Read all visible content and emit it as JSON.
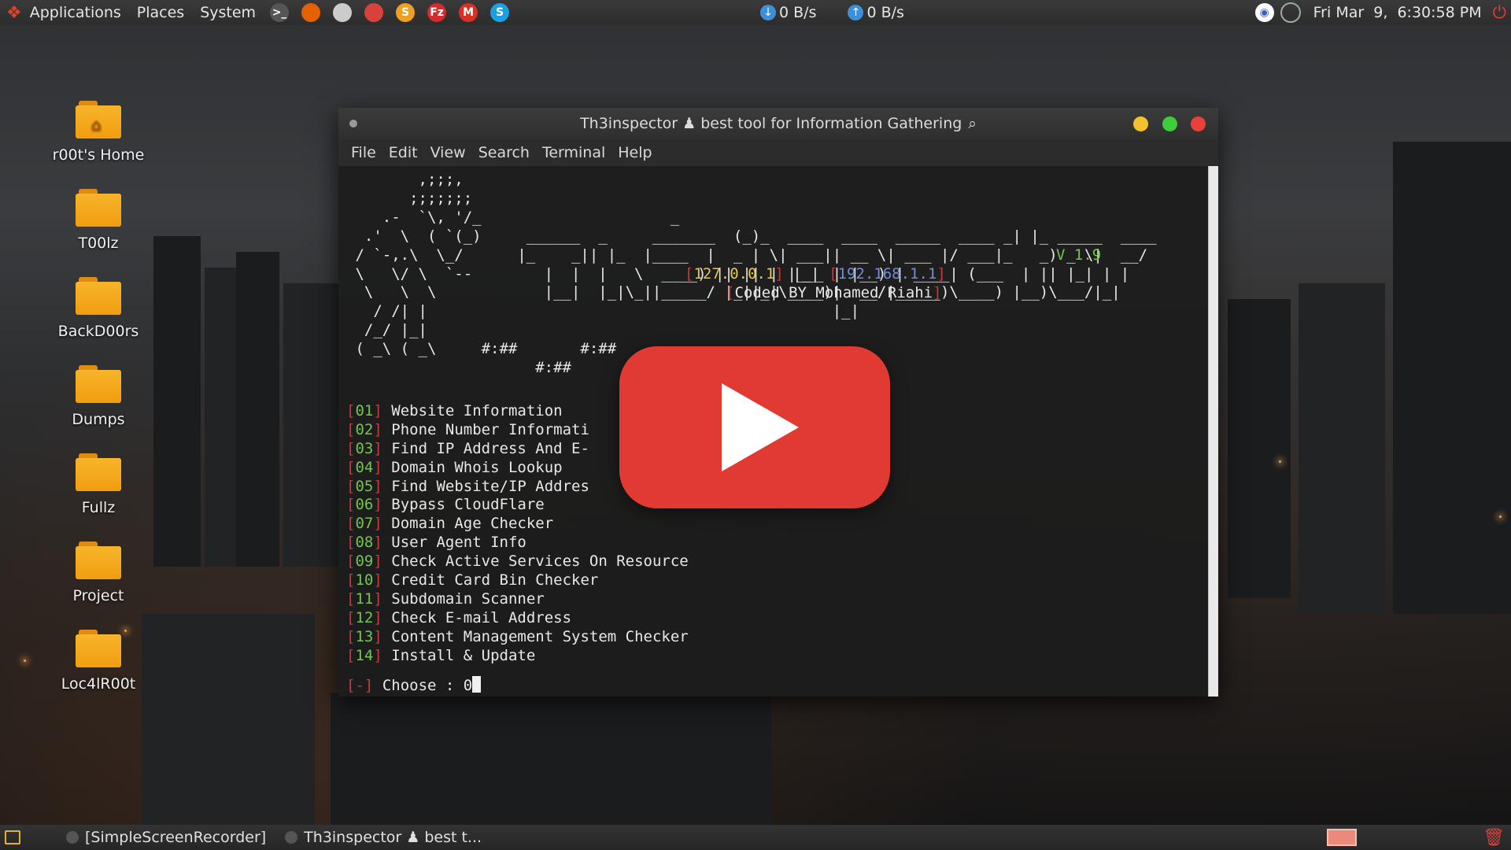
{
  "top_panel": {
    "menus": [
      "Applications",
      "Places",
      "System"
    ],
    "launchers": [
      {
        "name": "terminal-launcher-icon",
        "glyph": ">_",
        "color": "#555555"
      },
      {
        "name": "firefox-launcher-icon",
        "glyph": "",
        "color": "#e66000"
      },
      {
        "name": "app-launcher-icon",
        "glyph": "",
        "color": "#cccccc"
      },
      {
        "name": "lock-launcher-icon",
        "glyph": "",
        "color": "#d9423b"
      },
      {
        "name": "sublime-launcher-icon",
        "glyph": "S",
        "color": "#f0a020"
      },
      {
        "name": "filezilla-launcher-icon",
        "glyph": "Fz",
        "color": "#d52b2b"
      },
      {
        "name": "gmail-launcher-icon",
        "glyph": "M",
        "color": "#d93025"
      },
      {
        "name": "skype-launcher-icon",
        "glyph": "S",
        "color": "#1ba0e1"
      }
    ],
    "download_speed": "0 B/s",
    "upload_speed": "0 B/s",
    "clock": "Fri Mar  9,  6:30:58 PM"
  },
  "desktop_icons": [
    {
      "label": "r00t's Home",
      "home": true
    },
    {
      "label": "T00lz"
    },
    {
      "label": "BackD00rs"
    },
    {
      "label": "Dumps"
    },
    {
      "label": "Fullz"
    },
    {
      "label": "Project"
    },
    {
      "label": "Loc4lR00t"
    }
  ],
  "terminal": {
    "title": "Th3inspector ♟ best tool for Information Gathering",
    "menus": [
      "File",
      "Edit",
      "View",
      "Search",
      "Terminal",
      "Help"
    ],
    "version": "V 1.9",
    "local_ip": "127.0.0.1",
    "remote_ip": "192.168.1.1",
    "credit": "Coded BY Mohamed Riahi",
    "options": [
      {
        "num": "01",
        "label": "Website Information"
      },
      {
        "num": "02",
        "label": "Phone Number Informati"
      },
      {
        "num": "03",
        "label": "Find IP Address And E-"
      },
      {
        "num": "04",
        "label": "Domain Whois Lookup"
      },
      {
        "num": "05",
        "label": "Find Website/IP Addres"
      },
      {
        "num": "06",
        "label": "Bypass CloudFlare"
      },
      {
        "num": "07",
        "label": "Domain Age Checker"
      },
      {
        "num": "08",
        "label": "User Agent Info"
      },
      {
        "num": "09",
        "label": "Check Active Services On Resource"
      },
      {
        "num": "10",
        "label": "Credit Card Bin Checker"
      },
      {
        "num": "11",
        "label": "Subdomain Scanner"
      },
      {
        "num": "12",
        "label": "Check E-mail Address"
      },
      {
        "num": "13",
        "label": "Content Management System Checker"
      },
      {
        "num": "14",
        "label": "Install & Update"
      }
    ],
    "prompt_marker": "-",
    "prompt_label": "Choose : ",
    "prompt_value": "0"
  },
  "taskbar": {
    "tasks": [
      "[SimpleScreenRecorder]",
      "Th3inspector ♟ best t..."
    ]
  },
  "colors": {
    "accent_red": "#c43b3b",
    "accent_green": "#72c64f",
    "youtube_red": "#e03a32",
    "folder_orange": "#f5a623"
  }
}
